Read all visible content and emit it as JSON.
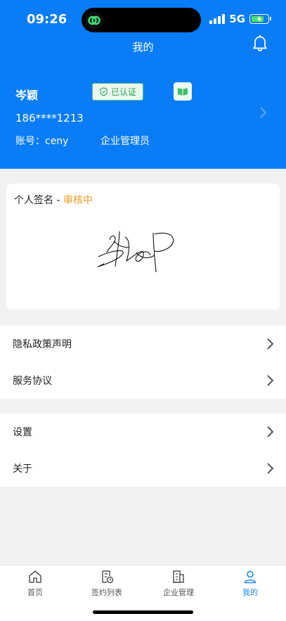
{
  "status_bar": {
    "time": "09:26",
    "network": "5G",
    "battery_level": 0.8
  },
  "header": {
    "title": "我的"
  },
  "profile": {
    "name": "岑颖",
    "verified_label": "已认证",
    "phone": "186****1213",
    "account_label": "账号：ceny",
    "role": "企业管理员"
  },
  "signature_card": {
    "title": "个人签名 - ",
    "status": "审核中"
  },
  "menu_group1": [
    {
      "label": "隐私政策声明"
    },
    {
      "label": "服务协议"
    }
  ],
  "menu_group2": [
    {
      "label": "设置"
    },
    {
      "label": "关于"
    }
  ],
  "tabs": [
    {
      "label": "首页",
      "icon": "home-icon"
    },
    {
      "label": "签约列表",
      "icon": "contract-list-icon"
    },
    {
      "label": "企业管理",
      "icon": "building-icon"
    },
    {
      "label": "我的",
      "icon": "user-icon",
      "active": true
    }
  ],
  "colors": {
    "primary": "#0a7cf5",
    "accent": "#f29b21",
    "verified": "#29a04f",
    "tab_active": "#1a8ae8"
  }
}
